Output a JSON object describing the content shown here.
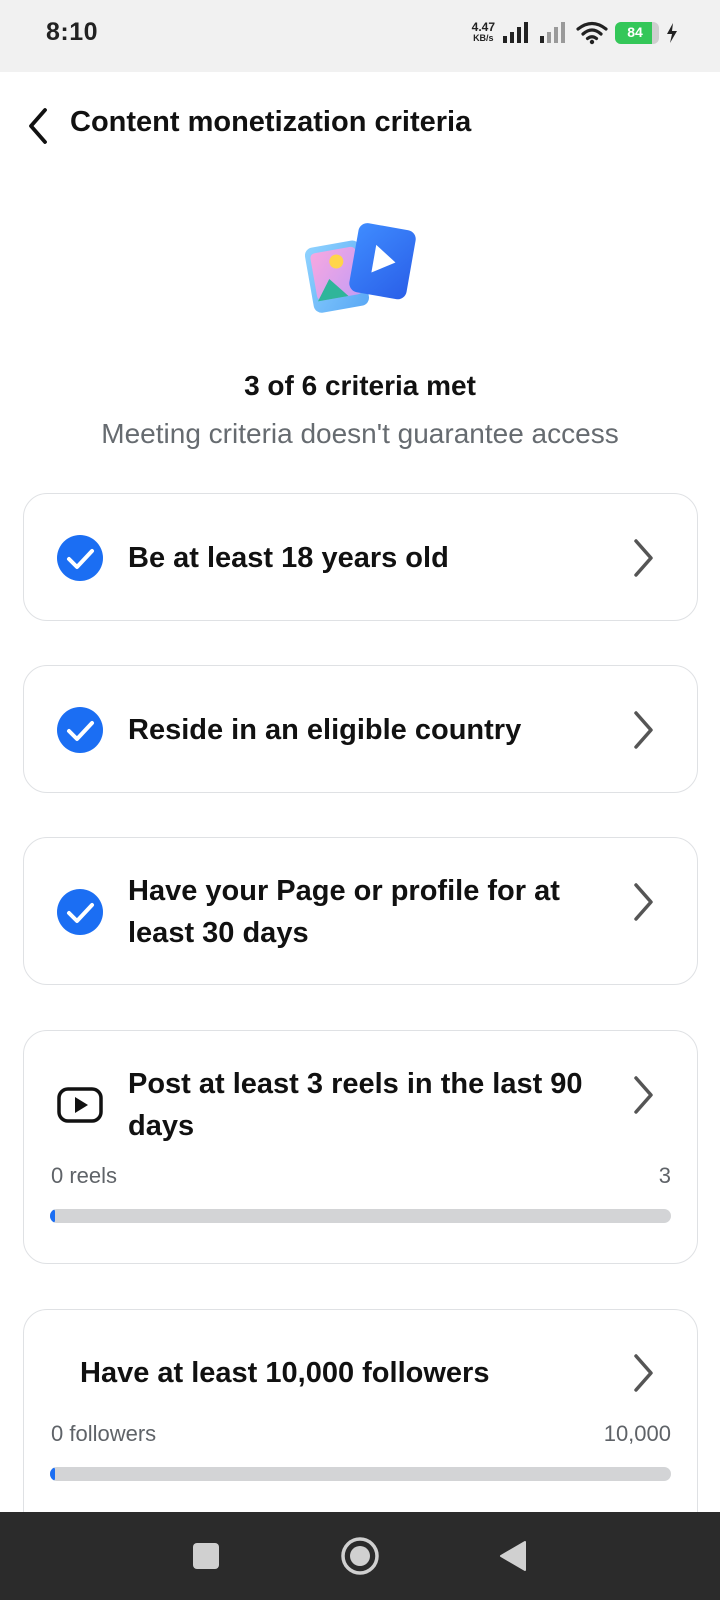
{
  "status_bar": {
    "time": "8:10",
    "net_speed_value": "4.47",
    "net_speed_unit": "KB/s",
    "battery_percent": "84",
    "battery_level": 0.84,
    "battery_color": "#34c759"
  },
  "header": {
    "back_icon": "chevron-left-icon",
    "title": "Content monetization criteria"
  },
  "summary": {
    "illustration": "photo-video-icon",
    "title": "3 of 6 criteria met",
    "subtitle": "Meeting criteria doesn't guarantee access"
  },
  "criteria": [
    {
      "label": "Be at least 18 years old",
      "icon": "check-circle-icon",
      "met": true
    },
    {
      "label": "Reside in an eligible country",
      "icon": "check-circle-icon",
      "met": true
    },
    {
      "label": "Have your Page or profile for at least 30 days",
      "icon": "check-circle-icon",
      "met": true
    },
    {
      "label": "Post at least 3 reels in the last 90 days",
      "icon": "reels-icon",
      "met": false,
      "progress": {
        "current_label": "0 reels",
        "target_label": "3",
        "current": 0,
        "target": 3
      }
    },
    {
      "label": "Have at least 10,000 followers",
      "icon": "none",
      "met": false,
      "progress": {
        "current_label": "0 followers",
        "target_label": "10,000",
        "current": 0,
        "target": 10000
      }
    }
  ],
  "colors": {
    "accent": "#1b6ef3",
    "track": "#d3d4d6",
    "nav_bar": "#2b2b2b"
  },
  "nav_bar": {
    "recents_icon": "square-icon",
    "home_icon": "circle-icon",
    "back_icon": "triangle-back-icon"
  }
}
